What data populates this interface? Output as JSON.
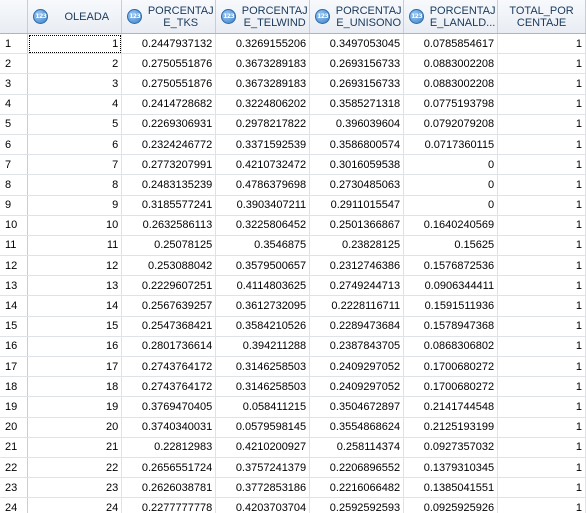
{
  "columns": [
    {
      "key": "oleada",
      "label": "OLEADA",
      "icon": "numeric-column-icon"
    },
    {
      "key": "tks",
      "label": "PORCENTAJE_TKS",
      "line1": "PORCENTAJ",
      "line2": "E_TKS",
      "icon": "numeric-column-icon"
    },
    {
      "key": "telwind",
      "label": "PORCENTAJE_TELWIND",
      "line1": "PORCENTAJ",
      "line2": "E_TELWIND",
      "icon": "numeric-column-icon"
    },
    {
      "key": "unisono",
      "label": "PORCENTAJE_UNISONO",
      "line1": "PORCENTAJ",
      "line2": "E_UNISONO",
      "icon": "numeric-column-icon"
    },
    {
      "key": "lanaldi",
      "label": "PORCENTAJE_LANALD...",
      "line1": "PORCENTAJ",
      "line2": "E_LANALD...",
      "icon": "numeric-column-icon"
    },
    {
      "key": "total",
      "label": "TOTAL_PORCENTAJE",
      "line1": "TOTAL_POR",
      "line2": "CENTAJE",
      "icon": null
    }
  ],
  "icon_text": "123",
  "rows": [
    {
      "n": "1",
      "oleada": "1",
      "tks": "0.2447937132",
      "telwind": "0.3269155206",
      "unisono": "0.3497053045",
      "lanaldi": "0.0785854617",
      "total": "1"
    },
    {
      "n": "2",
      "oleada": "2",
      "tks": "0.2750551876",
      "telwind": "0.3673289183",
      "unisono": "0.2693156733",
      "lanaldi": "0.0883002208",
      "total": "1"
    },
    {
      "n": "3",
      "oleada": "3",
      "tks": "0.2750551876",
      "telwind": "0.3673289183",
      "unisono": "0.2693156733",
      "lanaldi": "0.0883002208",
      "total": "1"
    },
    {
      "n": "4",
      "oleada": "4",
      "tks": "0.2414728682",
      "telwind": "0.3224806202",
      "unisono": "0.3585271318",
      "lanaldi": "0.0775193798",
      "total": "1"
    },
    {
      "n": "5",
      "oleada": "5",
      "tks": "0.2269306931",
      "telwind": "0.2978217822",
      "unisono": "0.396039604",
      "lanaldi": "0.0792079208",
      "total": "1"
    },
    {
      "n": "6",
      "oleada": "6",
      "tks": "0.2324246772",
      "telwind": "0.3371592539",
      "unisono": "0.3586800574",
      "lanaldi": "0.0717360115",
      "total": "1"
    },
    {
      "n": "7",
      "oleada": "7",
      "tks": "0.2773207991",
      "telwind": "0.4210732472",
      "unisono": "0.3016059538",
      "lanaldi": "0",
      "total": "1"
    },
    {
      "n": "8",
      "oleada": "8",
      "tks": "0.2483135239",
      "telwind": "0.4786379698",
      "unisono": "0.2730485063",
      "lanaldi": "0",
      "total": "1"
    },
    {
      "n": "9",
      "oleada": "9",
      "tks": "0.3185577241",
      "telwind": "0.3903407211",
      "unisono": "0.2911015547",
      "lanaldi": "0",
      "total": "1"
    },
    {
      "n": "10",
      "oleada": "10",
      "tks": "0.2632586113",
      "telwind": "0.3225806452",
      "unisono": "0.2501366867",
      "lanaldi": "0.1640240569",
      "total": "1"
    },
    {
      "n": "11",
      "oleada": "11",
      "tks": "0.25078125",
      "telwind": "0.3546875",
      "unisono": "0.23828125",
      "lanaldi": "0.15625",
      "total": "1"
    },
    {
      "n": "12",
      "oleada": "12",
      "tks": "0.253088042",
      "telwind": "0.3579500657",
      "unisono": "0.2312746386",
      "lanaldi": "0.1576872536",
      "total": "1"
    },
    {
      "n": "13",
      "oleada": "13",
      "tks": "0.2229607251",
      "telwind": "0.4114803625",
      "unisono": "0.2749244713",
      "lanaldi": "0.0906344411",
      "total": "1"
    },
    {
      "n": "14",
      "oleada": "14",
      "tks": "0.2567639257",
      "telwind": "0.3612732095",
      "unisono": "0.2228116711",
      "lanaldi": "0.1591511936",
      "total": "1"
    },
    {
      "n": "15",
      "oleada": "15",
      "tks": "0.2547368421",
      "telwind": "0.3584210526",
      "unisono": "0.2289473684",
      "lanaldi": "0.1578947368",
      "total": "1"
    },
    {
      "n": "16",
      "oleada": "16",
      "tks": "0.2801736614",
      "telwind": "0.394211288",
      "unisono": "0.2387843705",
      "lanaldi": "0.0868306802",
      "total": "1"
    },
    {
      "n": "17",
      "oleada": "17",
      "tks": "0.2743764172",
      "telwind": "0.3146258503",
      "unisono": "0.2409297052",
      "lanaldi": "0.1700680272",
      "total": "1"
    },
    {
      "n": "18",
      "oleada": "18",
      "tks": "0.2743764172",
      "telwind": "0.3146258503",
      "unisono": "0.2409297052",
      "lanaldi": "0.1700680272",
      "total": "1"
    },
    {
      "n": "19",
      "oleada": "19",
      "tks": "0.3769470405",
      "telwind": "0.058411215",
      "unisono": "0.3504672897",
      "lanaldi": "0.2141744548",
      "total": "1"
    },
    {
      "n": "20",
      "oleada": "20",
      "tks": "0.3740340031",
      "telwind": "0.0579598145",
      "unisono": "0.3554868624",
      "lanaldi": "0.2125193199",
      "total": "1"
    },
    {
      "n": "21",
      "oleada": "21",
      "tks": "0.22812983",
      "telwind": "0.4210200927",
      "unisono": "0.258114374",
      "lanaldi": "0.0927357032",
      "total": "1"
    },
    {
      "n": "22",
      "oleada": "22",
      "tks": "0.2656551724",
      "telwind": "0.3757241379",
      "unisono": "0.2206896552",
      "lanaldi": "0.1379310345",
      "total": "1"
    },
    {
      "n": "23",
      "oleada": "23",
      "tks": "0.2626038781",
      "telwind": "0.3772853186",
      "unisono": "0.2216066482",
      "lanaldi": "0.1385041551",
      "total": "1"
    },
    {
      "n": "24",
      "oleada": "24",
      "tks": "0.2277777778",
      "telwind": "0.4203703704",
      "unisono": "0.2592592593",
      "lanaldi": "0.0925925926",
      "total": "1"
    }
  ]
}
